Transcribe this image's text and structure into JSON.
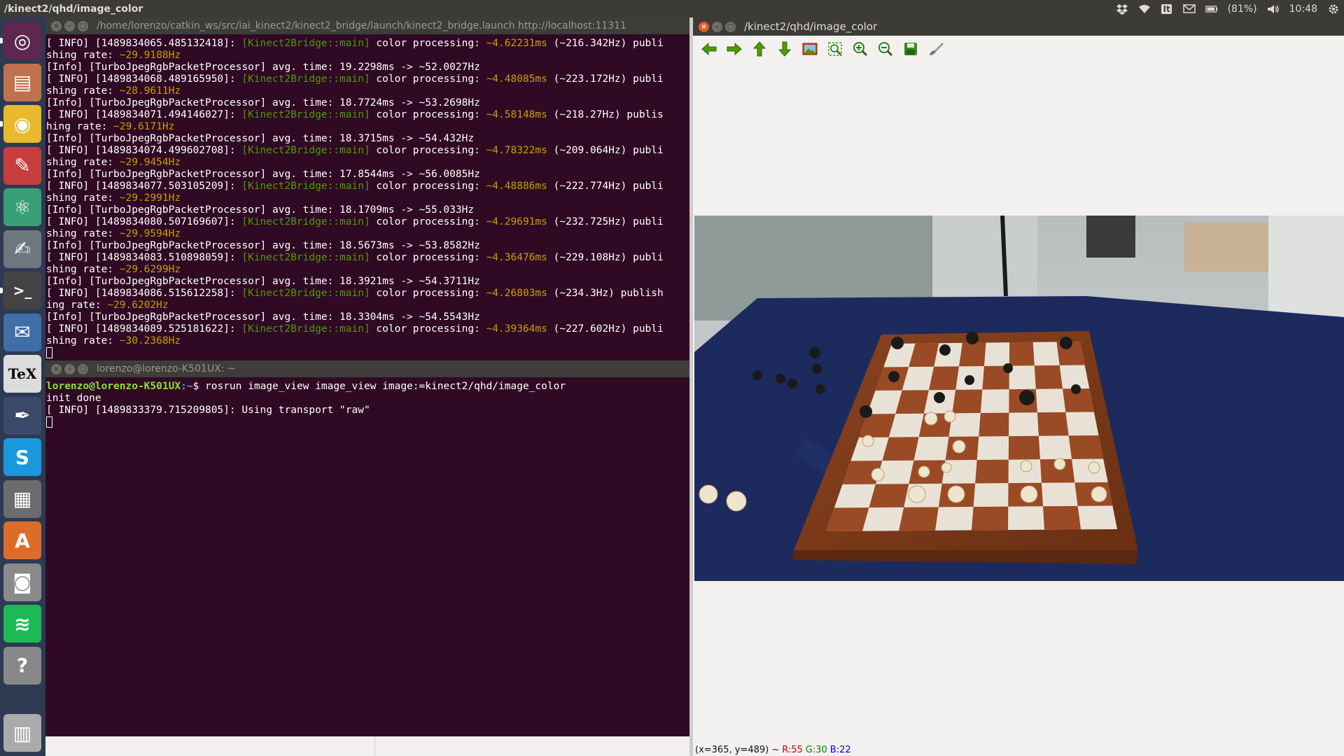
{
  "panel": {
    "title": "/kinect2/qhd/image_color",
    "battery": "(81%)",
    "clock": "10:48",
    "keyboard_layout": "It",
    "icons": [
      "dropbox-icon",
      "wifi-icon",
      "keyboard-icon",
      "mail-icon",
      "battery-icon",
      "volume-icon",
      "gear-icon"
    ]
  },
  "launcher": {
    "items": [
      {
        "name": "ubuntu-dash-icon",
        "color": "#5e2750"
      },
      {
        "name": "files-icon",
        "color": "#c0714d"
      },
      {
        "name": "chrome-icon",
        "color": "#e9b92c"
      },
      {
        "name": "evince-icon",
        "color": "#c73c3c"
      },
      {
        "name": "atom-icon",
        "color": "#3a9e75"
      },
      {
        "name": "text-editor-icon",
        "color": "#70787f"
      },
      {
        "name": "terminal-icon",
        "color": "#444444"
      },
      {
        "name": "thunderbird-icon",
        "color": "#3f6ea8"
      },
      {
        "name": "texmaker-icon",
        "color": "#dcdcdc"
      },
      {
        "name": "inkscape-icon",
        "color": "#3b4a6b"
      },
      {
        "name": "skype-icon",
        "color": "#1a98dc"
      },
      {
        "name": "calculator-icon",
        "color": "#6c6c6c"
      },
      {
        "name": "software-center-icon",
        "color": "#dd6b2a"
      },
      {
        "name": "camera-icon",
        "color": "#8a8a8a"
      },
      {
        "name": "spotify-icon",
        "color": "#1db954"
      },
      {
        "name": "help-icon",
        "color": "#888888"
      },
      {
        "name": "trash-icon",
        "color": "#aaaaaa"
      }
    ]
  },
  "terminal1": {
    "title": "/home/lorenzo/catkin_ws/src/iai_kinect2/kinect2_bridge/launch/kinect2_bridge.launch http://localhost:11311",
    "lines": [
      [
        [
          "w",
          "[ INFO] [1489834065.485132418]: "
        ],
        [
          "g",
          "[Kinect2Bridge::main]"
        ],
        [
          "w",
          " color processing: "
        ],
        [
          "y",
          "~4.62231ms"
        ],
        [
          "w",
          " (~216.342Hz) publi"
        ]
      ],
      [
        [
          "w",
          "shing rate: "
        ],
        [
          "y",
          "~29.9188Hz"
        ]
      ],
      [
        [
          "w",
          "[Info] [TurboJpegRgbPacketProcessor] avg. time: 19.2298ms -> ~52.0027Hz"
        ]
      ],
      [
        [
          "w",
          "[ INFO] [1489834068.489165950]: "
        ],
        [
          "g",
          "[Kinect2Bridge::main]"
        ],
        [
          "w",
          " color processing: "
        ],
        [
          "y",
          "~4.48085ms"
        ],
        [
          "w",
          " (~223.172Hz) publi"
        ]
      ],
      [
        [
          "w",
          "shing rate: "
        ],
        [
          "y",
          "~28.9611Hz"
        ]
      ],
      [
        [
          "w",
          "[Info] [TurboJpegRgbPacketProcessor] avg. time: 18.7724ms -> ~53.2698Hz"
        ]
      ],
      [
        [
          "w",
          "[ INFO] [1489834071.494146027]: "
        ],
        [
          "g",
          "[Kinect2Bridge::main]"
        ],
        [
          "w",
          " color processing: "
        ],
        [
          "y",
          "~4.58148ms"
        ],
        [
          "w",
          " (~218.27Hz) publis"
        ]
      ],
      [
        [
          "w",
          "hing rate: "
        ],
        [
          "y",
          "~29.6171Hz"
        ]
      ],
      [
        [
          "w",
          "[Info] [TurboJpegRgbPacketProcessor] avg. time: 18.3715ms -> ~54.432Hz"
        ]
      ],
      [
        [
          "w",
          "[ INFO] [1489834074.499602708]: "
        ],
        [
          "g",
          "[Kinect2Bridge::main]"
        ],
        [
          "w",
          " color processing: "
        ],
        [
          "y",
          "~4.78322ms"
        ],
        [
          "w",
          " (~209.064Hz) publi"
        ]
      ],
      [
        [
          "w",
          "shing rate: "
        ],
        [
          "y",
          "~29.9454Hz"
        ]
      ],
      [
        [
          "w",
          "[Info] [TurboJpegRgbPacketProcessor] avg. time: 17.8544ms -> ~56.0085Hz"
        ]
      ],
      [
        [
          "w",
          "[ INFO] [1489834077.503105209]: "
        ],
        [
          "g",
          "[Kinect2Bridge::main]"
        ],
        [
          "w",
          " color processing: "
        ],
        [
          "y",
          "~4.48886ms"
        ],
        [
          "w",
          " (~222.774Hz) publi"
        ]
      ],
      [
        [
          "w",
          "shing rate: "
        ],
        [
          "y",
          "~29.2991Hz"
        ]
      ],
      [
        [
          "w",
          "[Info] [TurboJpegRgbPacketProcessor] avg. time: 18.1709ms -> ~55.033Hz"
        ]
      ],
      [
        [
          "w",
          "[ INFO] [1489834080.507169607]: "
        ],
        [
          "g",
          "[Kinect2Bridge::main]"
        ],
        [
          "w",
          " color processing: "
        ],
        [
          "y",
          "~4.29691ms"
        ],
        [
          "w",
          " (~232.725Hz) publi"
        ]
      ],
      [
        [
          "w",
          "shing rate: "
        ],
        [
          "y",
          "~29.9594Hz"
        ]
      ],
      [
        [
          "w",
          "[Info] [TurboJpegRgbPacketProcessor] avg. time: 18.5673ms -> ~53.8582Hz"
        ]
      ],
      [
        [
          "w",
          "[ INFO] [1489834083.510898059]: "
        ],
        [
          "g",
          "[Kinect2Bridge::main]"
        ],
        [
          "w",
          " color processing: "
        ],
        [
          "y",
          "~4.36476ms"
        ],
        [
          "w",
          " (~229.108Hz) publi"
        ]
      ],
      [
        [
          "w",
          "shing rate: "
        ],
        [
          "y",
          "~29.6299Hz"
        ]
      ],
      [
        [
          "w",
          "[Info] [TurboJpegRgbPacketProcessor] avg. time: 18.3921ms -> ~54.3711Hz"
        ]
      ],
      [
        [
          "w",
          "[ INFO] [1489834086.515612258]: "
        ],
        [
          "g",
          "[Kinect2Bridge::main]"
        ],
        [
          "w",
          " color processing: "
        ],
        [
          "y",
          "~4.26803ms"
        ],
        [
          "w",
          " (~234.3Hz) publish"
        ]
      ],
      [
        [
          "w",
          "ing rate: "
        ],
        [
          "y",
          "~29.6202Hz"
        ]
      ],
      [
        [
          "w",
          "[Info] [TurboJpegRgbPacketProcessor] avg. time: 18.3304ms -> ~54.5543Hz"
        ]
      ],
      [
        [
          "w",
          "[ INFO] [1489834089.525181622]: "
        ],
        [
          "g",
          "[Kinect2Bridge::main]"
        ],
        [
          "w",
          " color processing: "
        ],
        [
          "y",
          "~4.39364ms"
        ],
        [
          "w",
          " (~227.602Hz) publi"
        ]
      ],
      [
        [
          "w",
          "shing rate: "
        ],
        [
          "y",
          "~30.2368Hz"
        ]
      ]
    ]
  },
  "terminal2": {
    "title": "lorenzo@lorenzo-K501UX: ~",
    "prompt_user": "lorenzo@lorenzo-K501UX",
    "prompt_path": ":~",
    "prompt_dollar": "$ ",
    "command": "rosrun image_view image_view image:=kinect2/qhd/image_color",
    "output": [
      "init done",
      "[ INFO] [1489833379.715209805]: Using transport \"raw\""
    ]
  },
  "image_view": {
    "title": "/kinect2/qhd/image_color",
    "toolbar": [
      "arrow-left-icon",
      "arrow-right-icon",
      "arrow-up-icon",
      "arrow-down-icon",
      "image-icon",
      "zoom-fit-icon",
      "zoom-in-icon",
      "zoom-out-icon",
      "save-icon",
      "brush-icon"
    ],
    "status": {
      "coords": "(x=365, y=489) ~",
      "r": "R:55",
      "g": "G:30",
      "b": "B:22"
    }
  }
}
